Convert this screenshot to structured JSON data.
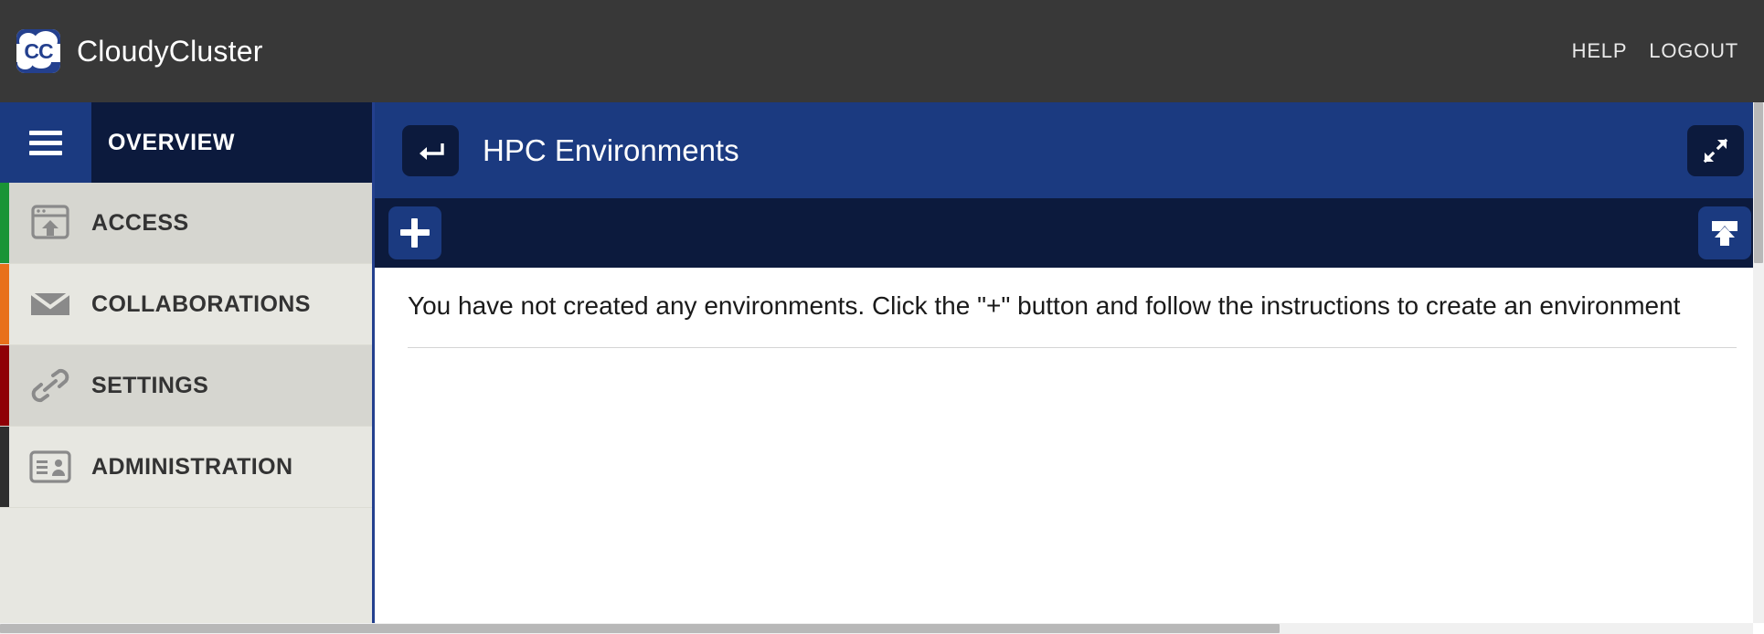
{
  "header": {
    "logo_text": "CC",
    "logo_icon": "cloudycluster-cloud-logo",
    "brand": "CloudyCluster",
    "nav": [
      {
        "label": "HELP",
        "name": "help-link"
      },
      {
        "label": "LOGOUT",
        "name": "logout-link"
      }
    ]
  },
  "sidebar": {
    "menu_icon": "hamburger-menu-icon",
    "overview_label": "OVERVIEW",
    "items": [
      {
        "label": "ACCESS",
        "icon": "window-upload-icon",
        "bar_color": "#1a9437",
        "row_shade": "#d6d6d0"
      },
      {
        "label": "COLLABORATIONS",
        "icon": "envelope-icon",
        "bar_color": "#e8701a",
        "row_shade": "#e7e7e1"
      },
      {
        "label": "SETTINGS",
        "icon": "link-chain-icon",
        "bar_color": "#8f0006",
        "row_shade": "#d6d6d0"
      },
      {
        "label": "ADMINISTRATION",
        "icon": "id-card-icon",
        "bar_color": "#2e2e2e",
        "row_shade": "#e7e7e1"
      }
    ]
  },
  "page": {
    "back_icon": "back-arrow-icon",
    "title": "HPC Environments",
    "expand_icon": "expand-fullscreen-icon"
  },
  "toolbar": {
    "add_icon": "plus-icon",
    "add_label": "+",
    "share_icon": "upload-share-icon"
  },
  "content": {
    "empty_message": "You have not created any environments. Click the \"+\" button and follow the instructions to create an environment"
  },
  "colors": {
    "header_bg": "#383838",
    "primary_blue": "#1b3a80",
    "dark_navy": "#0c1a3d",
    "sidebar_bg": "#e7e7e1",
    "icon_gray": "#8a8a8a"
  }
}
